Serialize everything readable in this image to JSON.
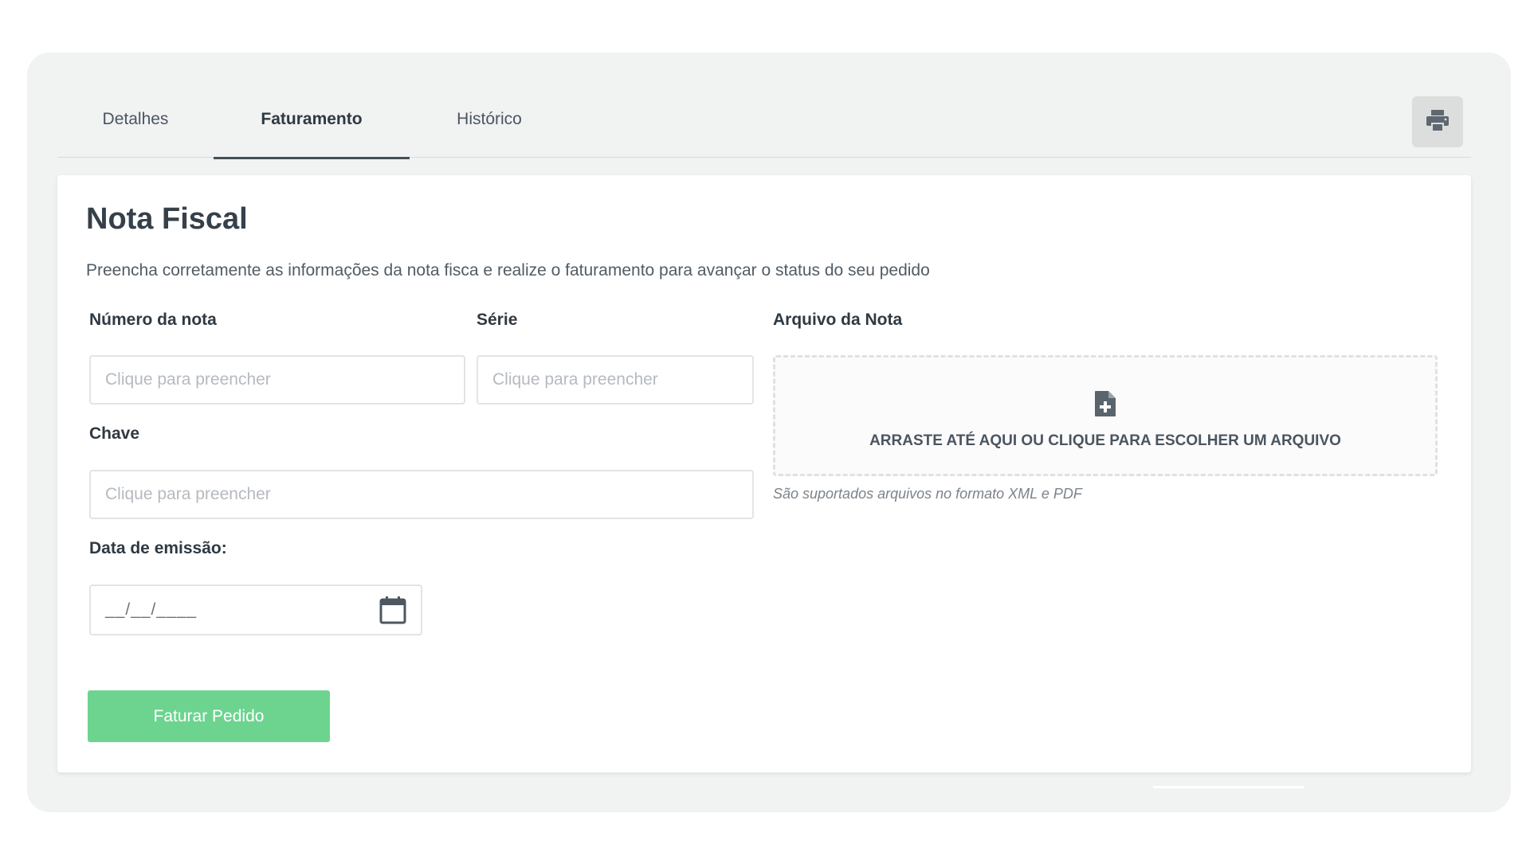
{
  "tabs": {
    "items": [
      {
        "label": "Detalhes"
      },
      {
        "label": "Faturamento"
      },
      {
        "label": "Histórico"
      }
    ],
    "active_index": 1
  },
  "toolbar": {
    "print_icon": "printer-icon"
  },
  "form": {
    "title": "Nota Fiscal",
    "description": "Preencha corretamente as informações da nota fisca e realize o faturamento para avançar o status do seu pedido",
    "numero": {
      "label": "Número da nota",
      "placeholder": "Clique para preencher",
      "value": ""
    },
    "serie": {
      "label": "Série",
      "placeholder": "Clique para preencher",
      "value": ""
    },
    "chave": {
      "label": "Chave",
      "placeholder": "Clique para preencher",
      "value": ""
    },
    "data_emissao": {
      "label": "Data de emissão:",
      "value": "__/__/____",
      "icon": "calendar-icon"
    },
    "arquivo": {
      "label": "Arquivo da Nota",
      "dropzone_text": "ARRASTE ATÉ AQUI OU CLIQUE PARA ESCOLHER UM ARQUIVO",
      "hint": "São suportados arquivos no formato XML e PDF",
      "icon": "file-add-icon"
    },
    "submit_label": "Faturar Pedido"
  },
  "colors": {
    "submit_bg": "#6cd48f",
    "card_bg": "#f1f2f2",
    "text_dark": "#35404a"
  }
}
